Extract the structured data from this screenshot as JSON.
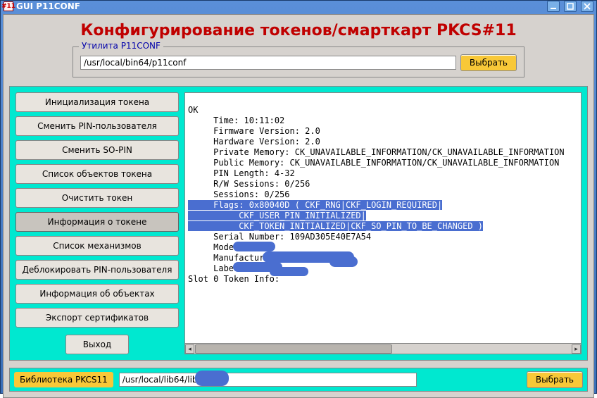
{
  "window": {
    "title": "GUI P11CONF",
    "icon_text": "#11"
  },
  "main_title": "Конфигурирование токенов/смарткарт PKCS#11",
  "util_group": {
    "legend": "Утилита P11CONF",
    "path": "/usr/local/bin64/p11conf",
    "select_label": "Выбрать"
  },
  "sidebar": {
    "buttons": [
      "Инициализация токена",
      "Сменить PIN-пользователя",
      "Сменить SO-PIN",
      "Список объектов токена",
      "Очистить токен",
      "Информация о токене",
      "Список механизмов",
      "Деблокировать PIN-пользователя",
      "Информация об объектах",
      "Экспорт сертификатов"
    ],
    "active_index": 5,
    "exit_label": "Выход"
  },
  "output": {
    "pre_text": "\nOK\n     Time: 10:11:02\n     Firmware Version: 2.0\n     Hardware Version: 2.0\n     Private Memory: CK_UNAVAILABLE_INFORMATION/CK_UNAVAILABLE_INFORMATION\n     Public Memory: CK_UNAVAILABLE_INFORMATION/CK_UNAVAILABLE_INFORMATION\n     PIN Length: 4-32\n     R/W Sessions: 0/256\n     Sessions: 0/256",
    "selected_text": "     Flags: 0x80040D ( CKF_RNG|CKF_LOGIN_REQUIRED|\n          CKF_USER_PIN_INITIALIZED|\n          CKF_TOKEN_INITIALIZED|CKF_SO_PIN_TO_BE_CHANGED )",
    "post_text": "\n     Serial Number: 109AD305E40E7A54\n     Model: \n     Manufacturer: \n     Label: \nSlot 0 Token Info:\n"
  },
  "library": {
    "label": "Библиотека PKCS11",
    "path": "/usr/local/lib64/lib",
    "select_label": "Выбрать"
  }
}
